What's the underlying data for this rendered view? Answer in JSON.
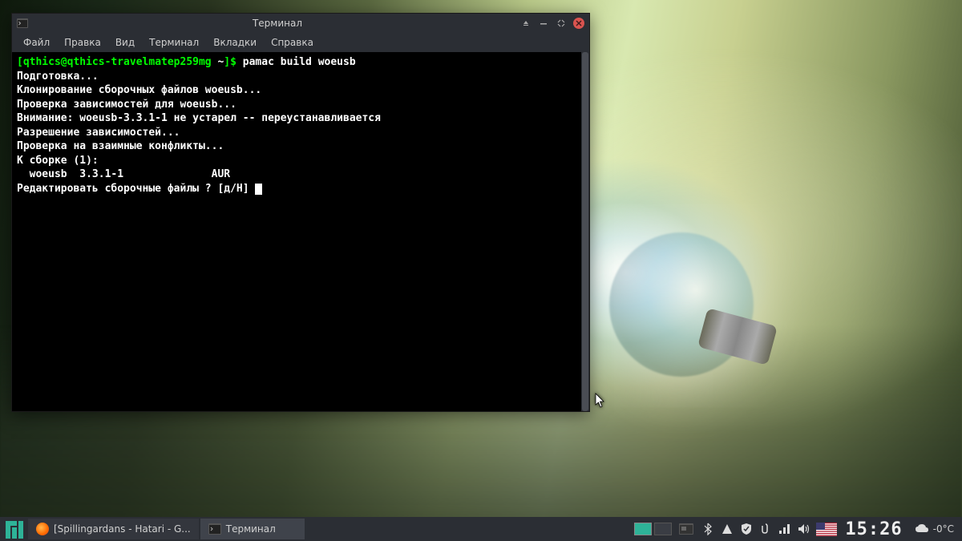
{
  "window": {
    "title": "Терминал"
  },
  "menubar": {
    "file": "Файл",
    "edit": "Правка",
    "view": "Вид",
    "terminal": "Терминал",
    "tabs": "Вкладки",
    "help": "Справка"
  },
  "terminal": {
    "prompt": {
      "open_bracket": "[",
      "user_host": "qthics@qthics-travelmatep259mg",
      "path": " ~",
      "close_bracket": "]",
      "dollar": "$ "
    },
    "command": "pamac build woeusb",
    "lines": [
      "Подготовка...",
      "Клонирование сборочных файлов woeusb...",
      "Проверка зависимостей для woeusb...",
      "Внимание: woeusb-3.3.1-1 не устарел -- переустанавливается",
      "Разрешение зависимостей...",
      "Проверка на взаимные конфликты...",
      "К сборке (1):",
      "  woeusb  3.3.1-1              AUR",
      "",
      "Редактировать сборочные файлы ? [д/Н] "
    ]
  },
  "taskbar": {
    "task1": "[Spillingardans - Hatari - G...",
    "task2": "Терминал"
  },
  "tray": {
    "clock": "15:26",
    "temperature": "-0°C"
  }
}
